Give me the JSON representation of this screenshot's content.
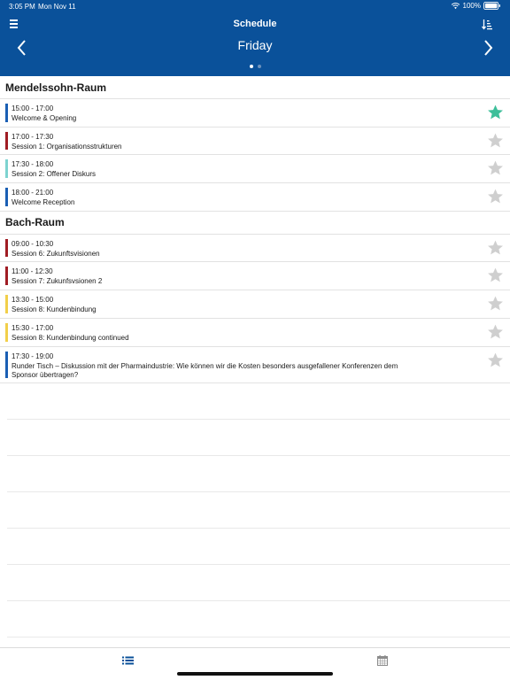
{
  "status_bar": {
    "time": "3:05 PM",
    "date": "Mon Nov 11",
    "battery": "100%"
  },
  "header": {
    "title": "Schedule",
    "day": "Friday",
    "page_count": 2,
    "active_page": 0,
    "icons": [
      "menu-icon",
      "sort-icon",
      "chevron-left-icon",
      "chevron-right-icon"
    ]
  },
  "colors": {
    "header_bg": "#0a519a",
    "star_active": "#3dbf9a",
    "star_inactive": "#cfcfcf",
    "tab_active": "#0a519a",
    "tab_inactive": "#8c8c8c"
  },
  "rooms": [
    {
      "name": "Mendelssohn-Raum",
      "sessions": [
        {
          "time": "15:00 - 17:00",
          "title": "Welcome & Opening",
          "color": "#1a5fb4",
          "starred": true
        },
        {
          "time": "17:00 - 17:30",
          "title": "Session 1: Organisationsstrukturen",
          "color": "#a01c24",
          "starred": false
        },
        {
          "time": "17:30 - 18:00",
          "title": "Session 2: Offener Diskurs",
          "color": "#7dd3d0",
          "starred": false
        },
        {
          "time": "18:00 - 21:00",
          "title": "Welcome Reception",
          "color": "#1a5fb4",
          "starred": false
        }
      ]
    },
    {
      "name": "Bach-Raum",
      "sessions": [
        {
          "time": "09:00 - 10:30",
          "title": "Session 6: Zukunftsvisionen",
          "color": "#a01c24",
          "starred": false
        },
        {
          "time": "11:00 - 12:30",
          "title": "Session 7: Zukunfsvsionen 2",
          "color": "#a01c24",
          "starred": false
        },
        {
          "time": "13:30 - 15:00",
          "title": "Session 8: Kundenbindung",
          "color": "#f2cf4a",
          "starred": false
        },
        {
          "time": "15:30 - 17:00",
          "title": "Session 8: Kundenbindung continued",
          "color": "#f2cf4a",
          "starred": false
        },
        {
          "time": "17:30 - 19:00",
          "title": "Runder Tisch – Diskussion mit der Pharmaindustrie: Wie können wir die Kosten besonders ausgefallener Konferenzen dem Sponsor übertragen?",
          "color": "#1a5fb4",
          "starred": false
        }
      ]
    }
  ],
  "tabs": [
    {
      "name": "tab-list",
      "icon": "list-icon",
      "active": true
    },
    {
      "name": "tab-calendar",
      "icon": "calendar-icon",
      "active": false
    }
  ]
}
